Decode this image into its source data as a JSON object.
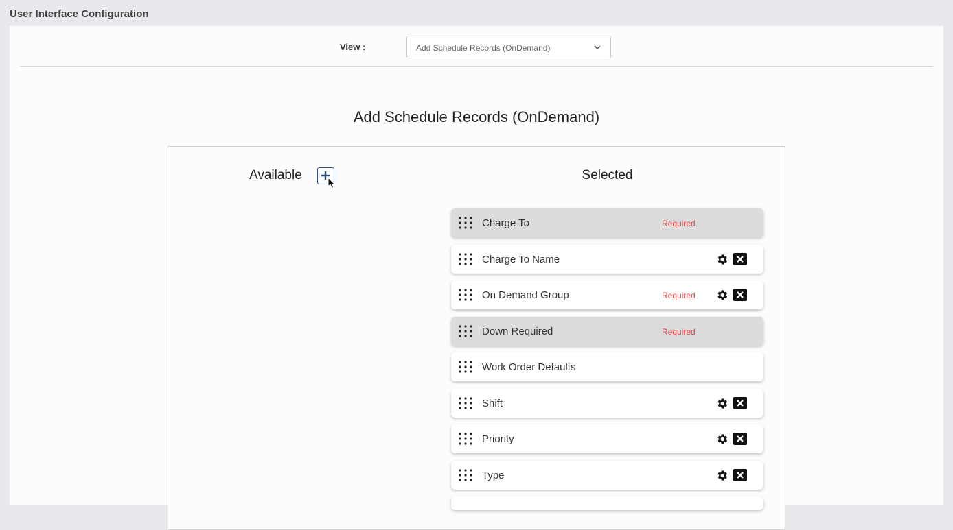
{
  "app": {
    "title": "User Interface Configuration"
  },
  "view": {
    "label": "View :",
    "selected": "Add Schedule Records (OnDemand)"
  },
  "page": {
    "title": "Add Schedule Records (OnDemand)"
  },
  "available": {
    "title": "Available"
  },
  "selected": {
    "title": "Selected",
    "items": [
      {
        "label": "Charge To",
        "required": "Required",
        "locked": true,
        "actions": false
      },
      {
        "label": "Charge To Name",
        "required": "",
        "locked": false,
        "actions": true
      },
      {
        "label": "On Demand Group",
        "required": "Required",
        "locked": false,
        "actions": true
      },
      {
        "label": "Down Required",
        "required": "Required",
        "locked": true,
        "actions": false
      },
      {
        "label": "Work Order Defaults",
        "required": "",
        "locked": false,
        "actions": false
      },
      {
        "label": "Shift",
        "required": "",
        "locked": false,
        "actions": true
      },
      {
        "label": "Priority",
        "required": "",
        "locked": false,
        "actions": true
      },
      {
        "label": "Type",
        "required": "",
        "locked": false,
        "actions": true
      }
    ]
  },
  "colors": {
    "required": "#e04848",
    "locked_bg": "#dcdcdc",
    "accent": "#2a4a7a"
  },
  "icons": {
    "drag": "drag-handle-icon",
    "gear": "gear-icon",
    "remove": "close-box-icon",
    "add": "plus-icon",
    "chevron": "chevron-down-icon"
  }
}
